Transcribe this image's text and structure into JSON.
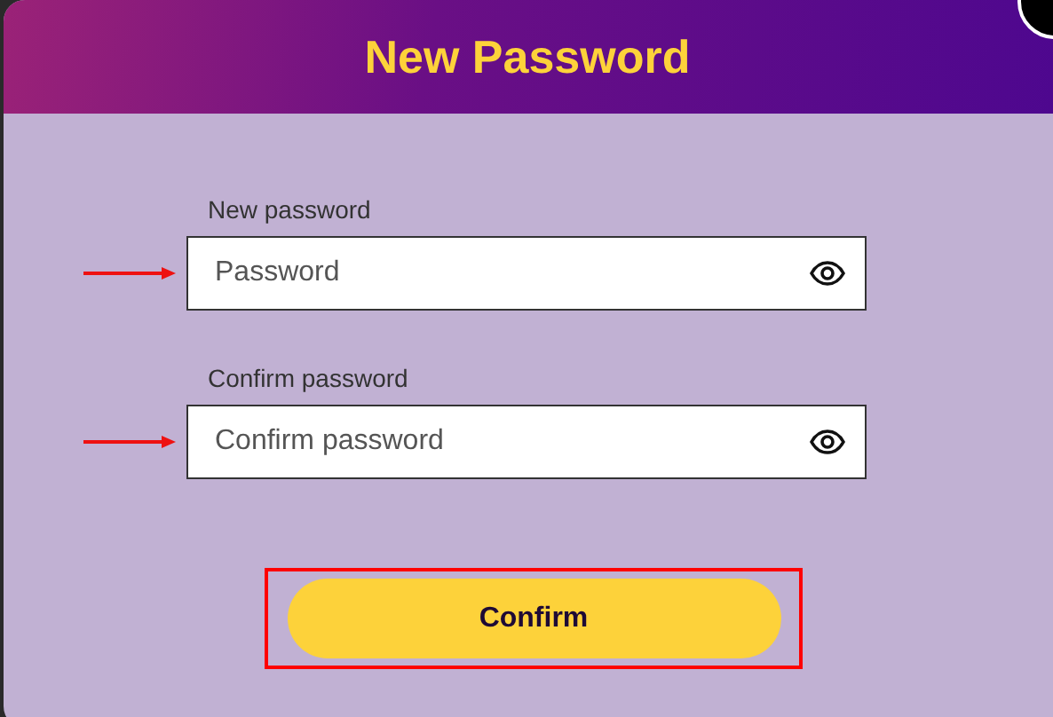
{
  "dialog": {
    "title": "New Password"
  },
  "fields": [
    {
      "label": "New password",
      "placeholder": "Password",
      "annotated": true
    },
    {
      "label": "Confirm password",
      "placeholder": "Confirm password",
      "annotated": true
    }
  ],
  "confirm_button": {
    "label": "Confirm",
    "highlighted": true
  }
}
